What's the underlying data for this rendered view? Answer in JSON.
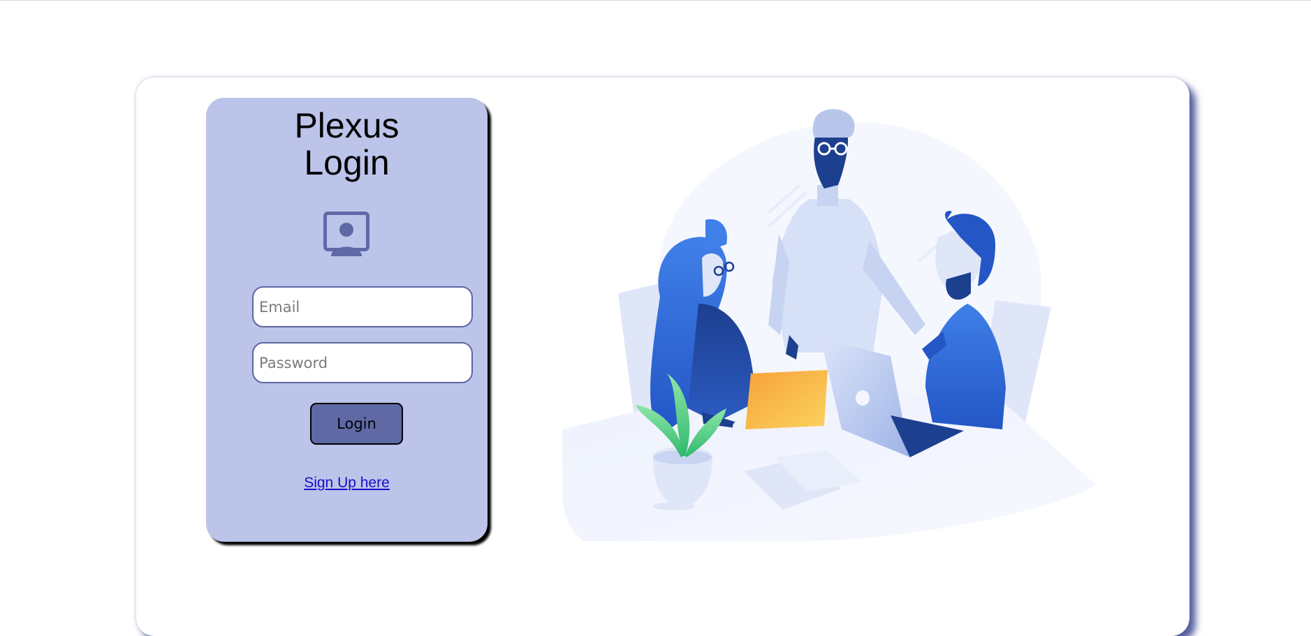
{
  "login": {
    "title_line1": "Plexus",
    "title_line2": "Login",
    "email_placeholder": "Email",
    "password_placeholder": "Password",
    "login_button_label": "Login",
    "signup_link_label": "Sign Up here"
  },
  "icons": {
    "user": "user-portrait-icon"
  },
  "colors": {
    "panel_background": "#bcc4ea",
    "accent": "#5f69a6",
    "card_shadow": "#4650a0",
    "link": "#1a0dcc"
  }
}
